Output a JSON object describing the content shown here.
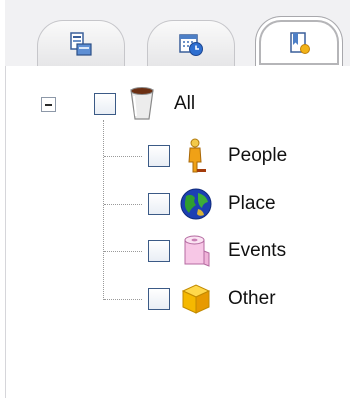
{
  "tabs": [
    {
      "icon": "layout-icon",
      "active": false
    },
    {
      "icon": "calendar-clock-icon",
      "active": false
    },
    {
      "icon": "bookmark-icon",
      "active": true
    }
  ],
  "tree": {
    "root": {
      "label": "All",
      "icon": "cup-icon",
      "checked": false,
      "expanded": true
    },
    "children": [
      {
        "label": "People",
        "icon": "person-icon",
        "checked": false
      },
      {
        "label": "Place",
        "icon": "globe-icon",
        "checked": false
      },
      {
        "label": "Events",
        "icon": "calendar-roll-icon",
        "checked": false
      },
      {
        "label": "Other",
        "icon": "box-icon",
        "checked": false
      }
    ]
  }
}
